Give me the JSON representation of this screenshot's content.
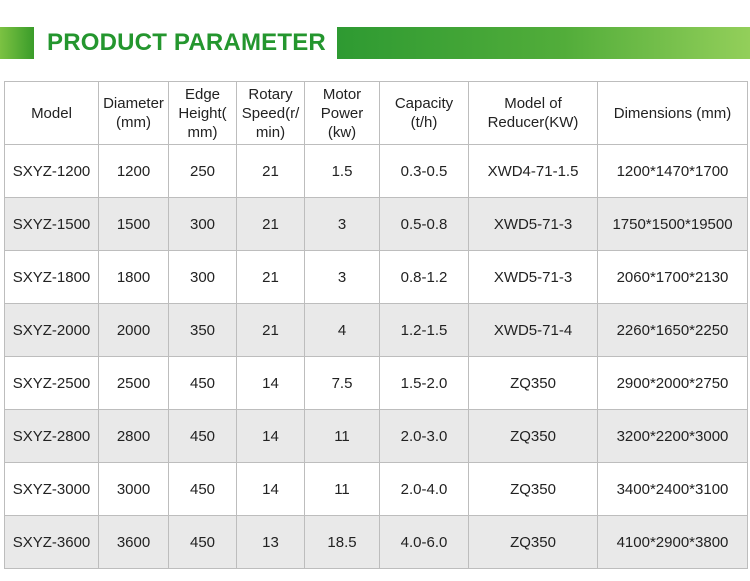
{
  "banner": {
    "title": "PRODUCT PARAMETER"
  },
  "colors": {
    "accent_green": "#24962e",
    "row_stripe": "#e9e9e9",
    "border": "#bdbdbd"
  },
  "table": {
    "headers": [
      "Model",
      "Diameter (mm)",
      "Edge Height( mm)",
      "Rotary Speed(r/ min)",
      "Motor Power (kw)",
      "Capacity (t/h)",
      "Model of Reducer(KW)",
      "Dimensions (mm)"
    ],
    "rows": [
      [
        "SXYZ-1200",
        "1200",
        "250",
        "21",
        "1.5",
        "0.3-0.5",
        "XWD4-71-1.5",
        "1200*1470*1700"
      ],
      [
        "SXYZ-1500",
        "1500",
        "300",
        "21",
        "3",
        "0.5-0.8",
        "XWD5-71-3",
        "1750*1500*19500"
      ],
      [
        "SXYZ-1800",
        "1800",
        "300",
        "21",
        "3",
        "0.8-1.2",
        "XWD5-71-3",
        "2060*1700*2130"
      ],
      [
        "SXYZ-2000",
        "2000",
        "350",
        "21",
        "4",
        "1.2-1.5",
        "XWD5-71-4",
        "2260*1650*2250"
      ],
      [
        "SXYZ-2500",
        "2500",
        "450",
        "14",
        "7.5",
        "1.5-2.0",
        "ZQ350",
        "2900*2000*2750"
      ],
      [
        "SXYZ-2800",
        "2800",
        "450",
        "14",
        "11",
        "2.0-3.0",
        "ZQ350",
        "3200*2200*3000"
      ],
      [
        "SXYZ-3000",
        "3000",
        "450",
        "14",
        "11",
        "2.0-4.0",
        "ZQ350",
        "3400*2400*3100"
      ],
      [
        "SXYZ-3600",
        "3600",
        "450",
        "13",
        "18.5",
        "4.0-6.0",
        "ZQ350",
        "4100*2900*3800"
      ]
    ]
  }
}
